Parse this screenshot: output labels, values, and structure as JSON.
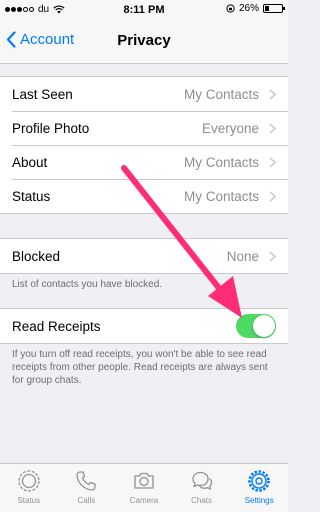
{
  "status_bar": {
    "carrier": "du",
    "time": "8:11 PM",
    "battery": "26%",
    "battery_level": 0.26
  },
  "nav": {
    "back_label": "Account",
    "title": "Privacy"
  },
  "privacy_rows": [
    {
      "label": "Last Seen",
      "value": "My Contacts"
    },
    {
      "label": "Profile Photo",
      "value": "Everyone"
    },
    {
      "label": "About",
      "value": "My Contacts"
    },
    {
      "label": "Status",
      "value": "My Contacts"
    }
  ],
  "blocked": {
    "label": "Blocked",
    "value": "None",
    "footnote": "List of contacts you have blocked."
  },
  "read_receipts": {
    "label": "Read Receipts",
    "enabled": true,
    "footnote": "If you turn off read receipts, you won't be able to see read receipts from other people. Read receipts are always sent for group chats."
  },
  "tabs": [
    {
      "label": "Status",
      "icon": "status-icon"
    },
    {
      "label": "Calls",
      "icon": "phone-icon"
    },
    {
      "label": "Camera",
      "icon": "camera-icon"
    },
    {
      "label": "Chats",
      "icon": "chats-icon"
    },
    {
      "label": "Settings",
      "icon": "gear-icon",
      "active": true
    }
  ],
  "colors": {
    "accent": "#007aff",
    "toggle_on": "#4cd964",
    "annotation_arrow": "#ff2d78"
  }
}
